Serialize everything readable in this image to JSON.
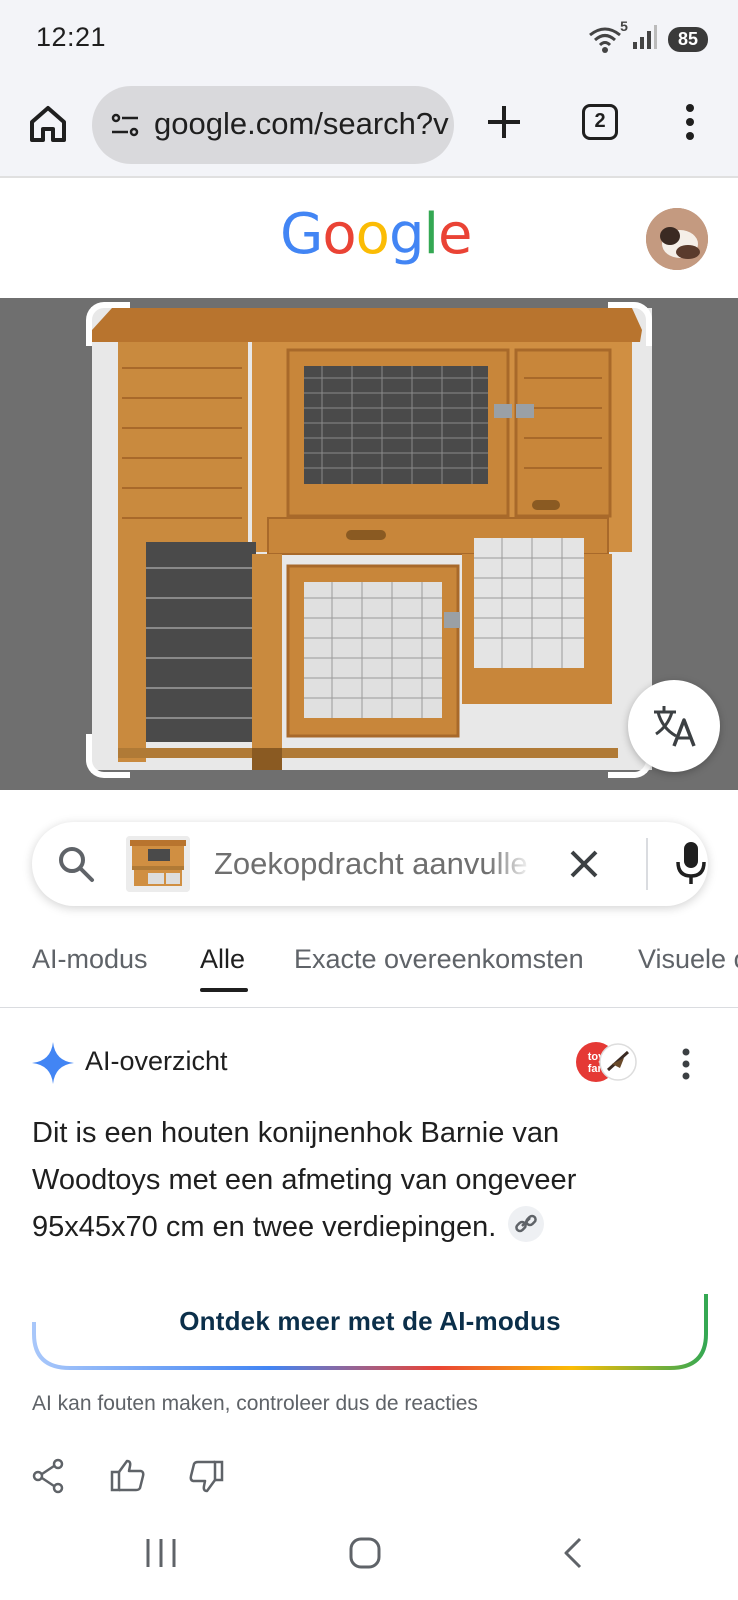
{
  "status": {
    "time": "12:21",
    "battery": "85",
    "wifi_badge": "5"
  },
  "browser": {
    "url": "google.com/search?v",
    "tab_count": "2"
  },
  "google": {
    "logo_letters": [
      "G",
      "o",
      "o",
      "g",
      "l",
      "e"
    ],
    "logo_colors": [
      "#4285F4",
      "#EA4335",
      "#FBBC05",
      "#4285F4",
      "#34A853",
      "#EA4335"
    ]
  },
  "search": {
    "placeholder": "Zoekopdracht aanvullen"
  },
  "tabs": [
    {
      "label": "AI-modus"
    },
    {
      "label": "Alle"
    },
    {
      "label": "Exacte overeenkomsten"
    },
    {
      "label": "Visuele overeenkomsten"
    }
  ],
  "ai_overview": {
    "title": "AI-overzicht",
    "body": "Dit is een houten konijnenhok Barnie van Woodtoys met een afmeting van ongeveer 95x45x70 cm en twee verdiepingen.",
    "button_label": "Ontdek meer met de AI-modus",
    "disclaimer": "AI kan fouten maken, controleer dus de reacties",
    "source_logo_text": "toy fan"
  },
  "colors": {
    "accent_blue": "#4285F4",
    "status_bg": "#f3f4f8",
    "image_bg": "#6f6f6f"
  }
}
